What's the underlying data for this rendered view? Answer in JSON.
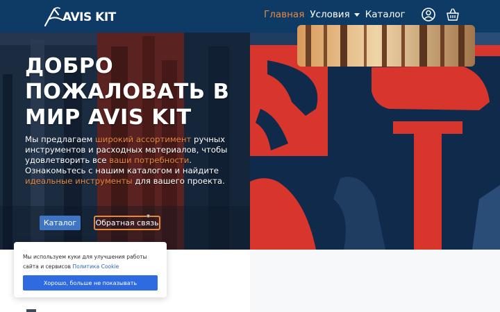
{
  "brand": {
    "name": "AVIS KIT"
  },
  "nav": {
    "items": [
      {
        "label": "Главная",
        "active": true
      },
      {
        "label": "Условия",
        "has_dropdown": true
      },
      {
        "label": "Каталог"
      }
    ],
    "icons": [
      "user-icon",
      "cart-icon"
    ]
  },
  "hero": {
    "title": "ДОБРО ПОЖАЛОВАТЬ В МИР AVIS KIT",
    "paragraph": [
      {
        "text": "Мы предлагаем ",
        "highlight": false
      },
      {
        "text": "широкий ассортимент",
        "highlight": true
      },
      {
        "text": " ручных инструментов и расходных материалов, чтобы удовлетворить все ",
        "highlight": false
      },
      {
        "text": "ваши потребности",
        "highlight": true
      },
      {
        "text": ". Ознакомьтесь с нашим каталогом и найдите ",
        "highlight": false
      },
      {
        "text": "идеальные инструменты",
        "highlight": true
      },
      {
        "text": " для вашего проекта.",
        "highlight": false
      }
    ],
    "primary_button": "Каталог",
    "secondary_button": "Обратная связь"
  },
  "cookie": {
    "text": "Мы используем куки для улучшения работы сайта и сервисов ",
    "link": "Политика Cookie",
    "button": "Хорошо, больше не показывать"
  },
  "colors": {
    "header_bg": "#0e3a66",
    "accent": "#e8893e",
    "primary_button": "#3f75c2",
    "cookie_button": "#2e6be0",
    "hero_red": "#d8362c",
    "hero_navy": "#0f2a4a"
  }
}
